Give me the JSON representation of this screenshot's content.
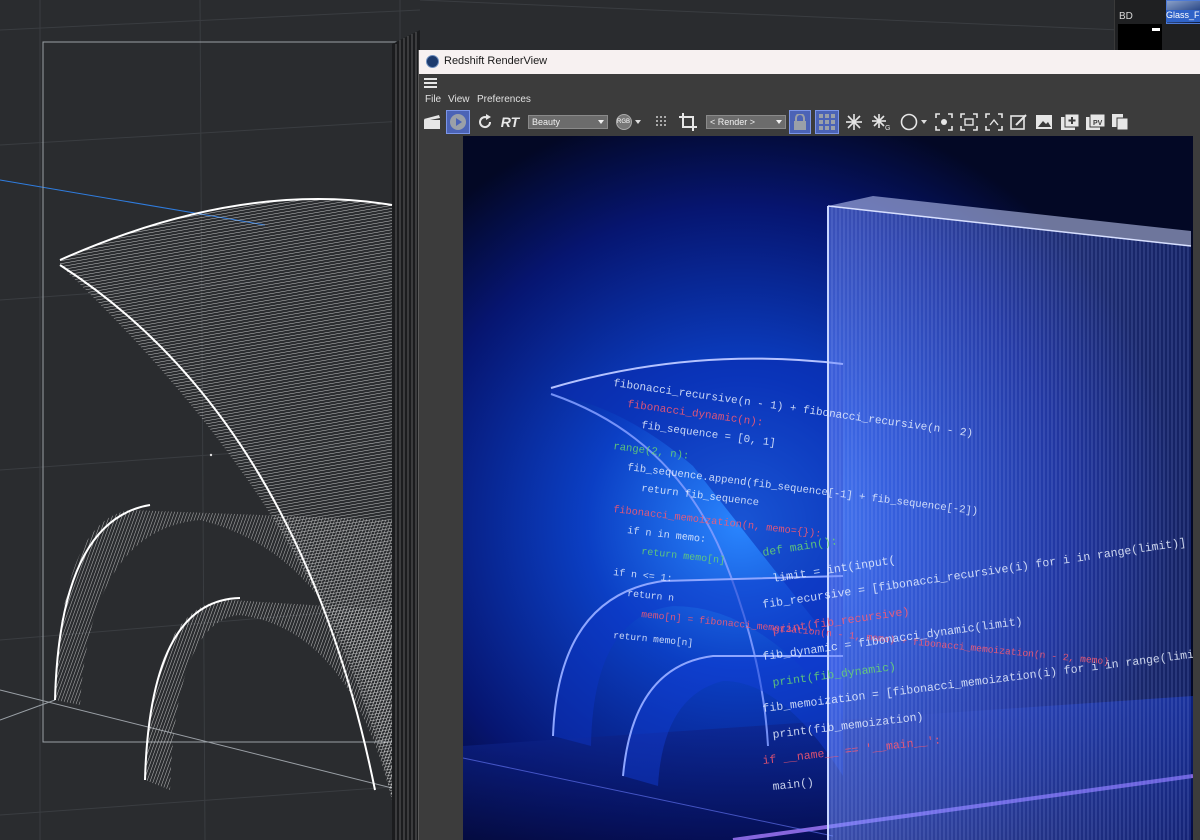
{
  "thumbnail_panel": {
    "item_a_label": "BD",
    "item_b_label": "Glass_Fr"
  },
  "renderview": {
    "title": "Redshift RenderView",
    "menu": [
      "File",
      "View",
      "Preferences"
    ],
    "toolbar": {
      "rt_label": "RT",
      "aov_select": "Beauty",
      "rgb_label": "RGB",
      "render_select": "< Render >",
      "pv_label": "PV"
    }
  },
  "render_code_text": [
    "fibonacci_recursive(n - 1) + fibonacci_recursive(n - 2)",
    "fibonacci_dynamic(n):",
    "fib_sequence = [0, 1]",
    "range(2, n):",
    "fib_sequence.append(fib_sequence[-1] + fib_sequence[-2])",
    "return fib_sequence",
    "fibonacci_memoization(n, memo={}):",
    "if n in memo:",
    "return memo[n]",
    "if n <= 1:",
    "return n",
    "memo[n] = fibonacci_memoization(n - 1, memo) + fibonacci_memoization(n - 2, memo)",
    "return memo[n]",
    "def main():",
    "limit = int(input(",
    "fib_recursive = [fibonacci_recursive(i) for i in range(limit)]",
    "print(fib_recursive)",
    "fib_dynamic = fibonacci_dynamic(limit)",
    "print(fib_dynamic)",
    "fib_memoization = [fibonacci_memoization(i) for i in range(limit)]",
    "print(fib_memoization)",
    "if __name__ == '__main__':",
    "main()"
  ],
  "colors": {
    "render_bg_deep": "#050a2a",
    "render_glow": "#1f6df0",
    "code_white": "#e8f0ff",
    "code_red": "#ff5a6e",
    "code_green": "#6ad66f",
    "accent_active": "#4b63b6"
  }
}
